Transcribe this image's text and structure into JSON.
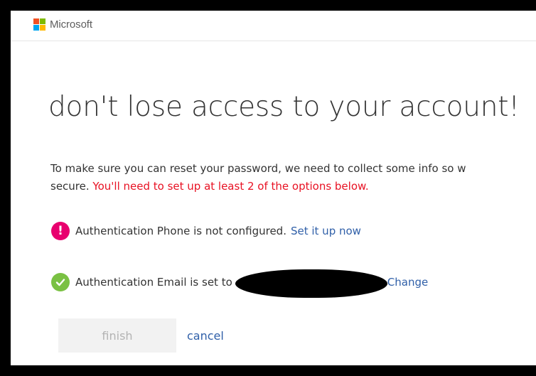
{
  "header": {
    "brand": "Microsoft",
    "logo_colors": [
      "#f25022",
      "#7fba00",
      "#00a4ef",
      "#ffb900"
    ]
  },
  "main": {
    "title": "don't lose access to your account!",
    "intro_text": "To make sure you can reset your password, we need to collect some info so w",
    "intro_text_line2": "secure.",
    "intro_warning": "You'll need to set up at least 2 of the options below."
  },
  "options": {
    "phone": {
      "icon": "alert-icon",
      "status_text": "Authentication Phone is not configured.",
      "action_label": "Set it up now"
    },
    "email": {
      "icon": "check-icon",
      "status_text": "Authentication Email is set to",
      "action_label": "Change"
    }
  },
  "actions": {
    "finish_label": "finish",
    "cancel_label": "cancel"
  },
  "colors": {
    "warning": "#e81123",
    "alert_icon": "#e8006e",
    "ok_icon": "#7ac143",
    "link": "#2f5fa8"
  }
}
